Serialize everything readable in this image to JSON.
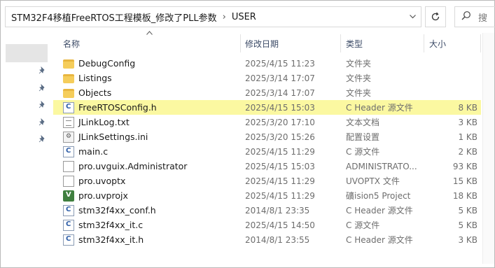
{
  "address_bar": {
    "breadcrumbs": [
      "STM32F4移植FreeRTOS工程模板_修改了PLL参数",
      "USER"
    ],
    "separator": "›",
    "dropdown_icon": "chevron-down-icon",
    "refresh_icon": "refresh-icon",
    "search_icon": "search-icon",
    "search_placeholder": "搜"
  },
  "columns": {
    "name": "名称",
    "date": "修改日期",
    "type": "类型",
    "size": "大小"
  },
  "highlight_color": "#fbf8a1",
  "files": [
    {
      "name": "DebugConfig",
      "date": "2025/4/15 11:23",
      "type": "文件夹",
      "size": "",
      "icon": "folder-icon"
    },
    {
      "name": "Listings",
      "date": "2025/3/14 17:07",
      "type": "文件夹",
      "size": "",
      "icon": "folder-icon"
    },
    {
      "name": "Objects",
      "date": "2025/3/14 17:07",
      "type": "文件夹",
      "size": "",
      "icon": "folder-icon"
    },
    {
      "name": "FreeRTOSConfig.h",
      "date": "2025/4/15 15:03",
      "type": "C Header 源文件",
      "size": "8 KB",
      "icon": "c-source-icon",
      "highlighted": true
    },
    {
      "name": "JLinkLog.txt",
      "date": "2025/3/20 17:10",
      "type": "文本文档",
      "size": "3 KB",
      "icon": "text-file-icon"
    },
    {
      "name": "JLinkSettings.ini",
      "date": "2025/3/20 15:26",
      "type": "配置设置",
      "size": "1 KB",
      "icon": "settings-file-icon"
    },
    {
      "name": "main.c",
      "date": "2025/4/15 11:29",
      "type": "C 源文件",
      "size": "2 KB",
      "icon": "c-source-icon"
    },
    {
      "name": "pro.uvguix.Administrator",
      "date": "2025/4/15 15:03",
      "type": "ADMINISTRATO...",
      "size": "93 KB",
      "icon": "file-icon"
    },
    {
      "name": "pro.uvoptx",
      "date": "2025/4/15 11:29",
      "type": "UVOPTX 文件",
      "size": "15 KB",
      "icon": "file-icon"
    },
    {
      "name": "pro.uvprojx",
      "date": "2025/4/15 11:29",
      "type": "礦ision5 Project",
      "size": "18 KB",
      "icon": "keil-project-icon"
    },
    {
      "name": "stm32f4xx_conf.h",
      "date": "2014/8/1 23:35",
      "type": "C Header 源文件",
      "size": "5 KB",
      "icon": "c-source-icon"
    },
    {
      "name": "stm32f4xx_it.c",
      "date": "2025/4/15 14:50",
      "type": "C 源文件",
      "size": "5 KB",
      "icon": "c-source-icon"
    },
    {
      "name": "stm32f4xx_it.h",
      "date": "2014/8/1 23:55",
      "type": "C Header 源文件",
      "size": "3 KB",
      "icon": "c-source-icon"
    }
  ]
}
